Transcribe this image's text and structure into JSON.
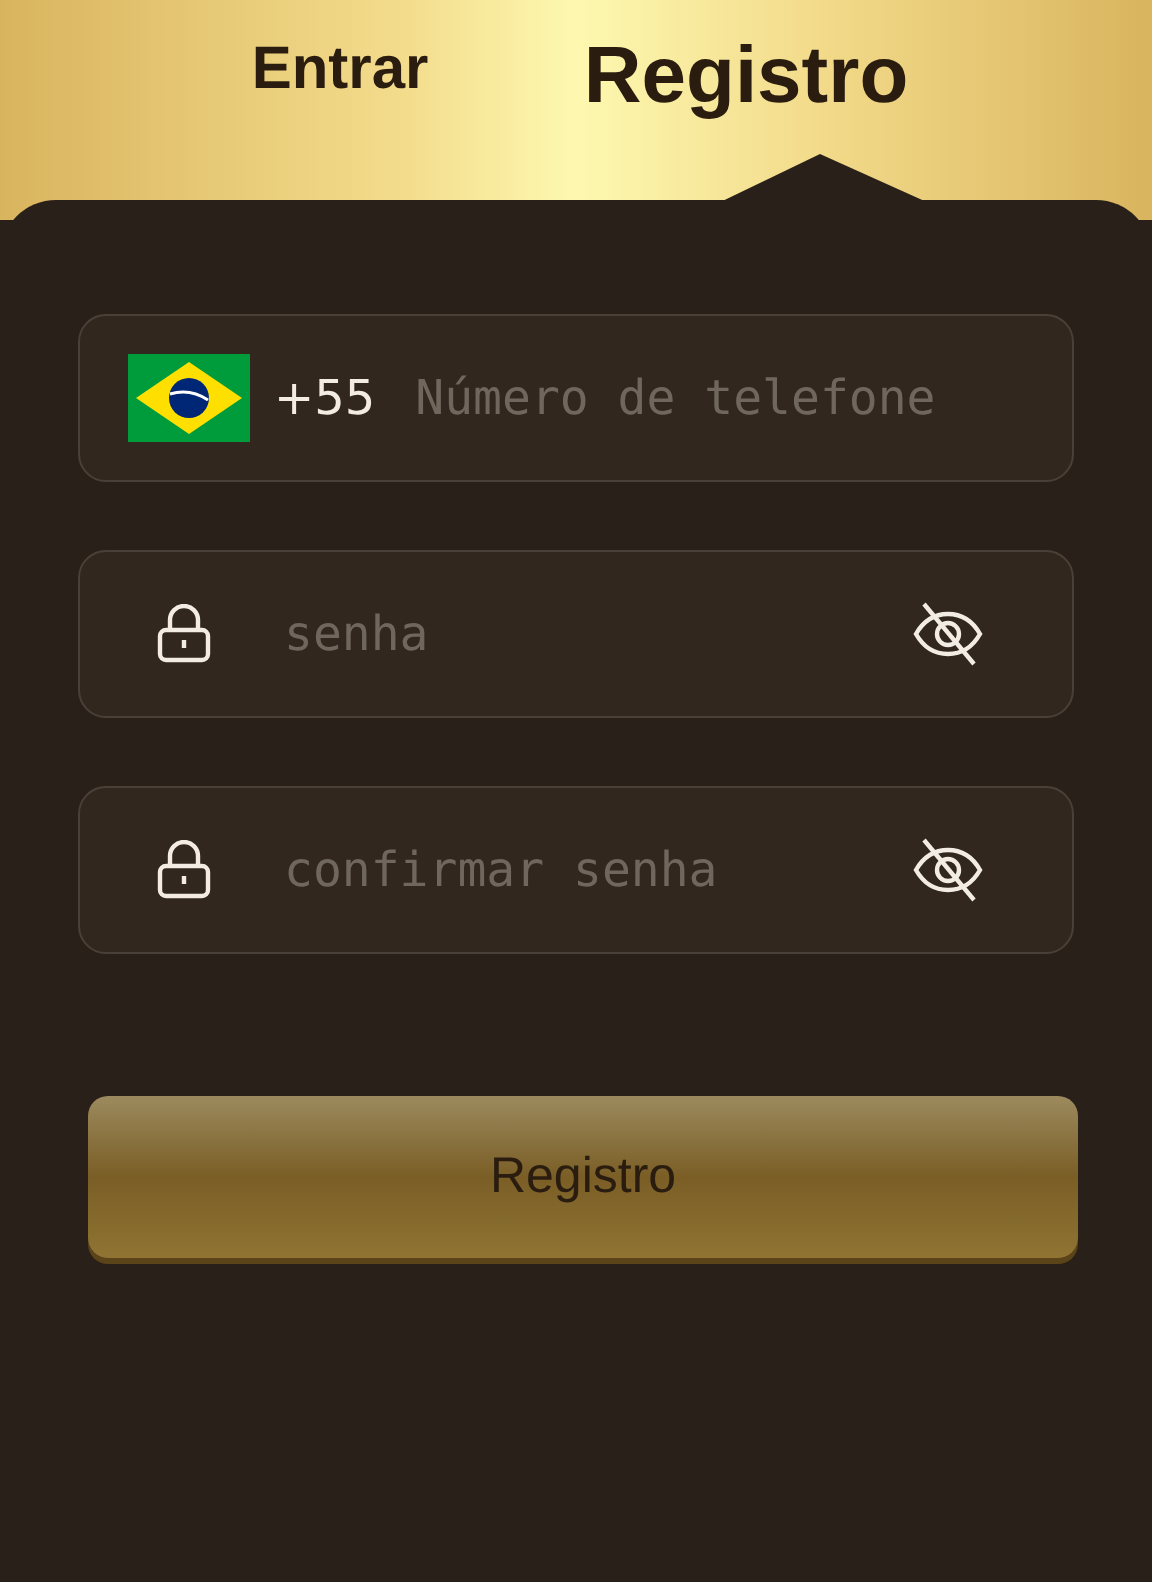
{
  "tabs": [
    {
      "label": "Entrar",
      "selected": false
    },
    {
      "label": "Registro",
      "selected": true
    }
  ],
  "phone": {
    "country_code": "+55",
    "placeholder": "Número de telefone"
  },
  "password": {
    "placeholder": "senha"
  },
  "confirm_password": {
    "placeholder": "confirmar senha"
  },
  "submit": "Registro"
}
